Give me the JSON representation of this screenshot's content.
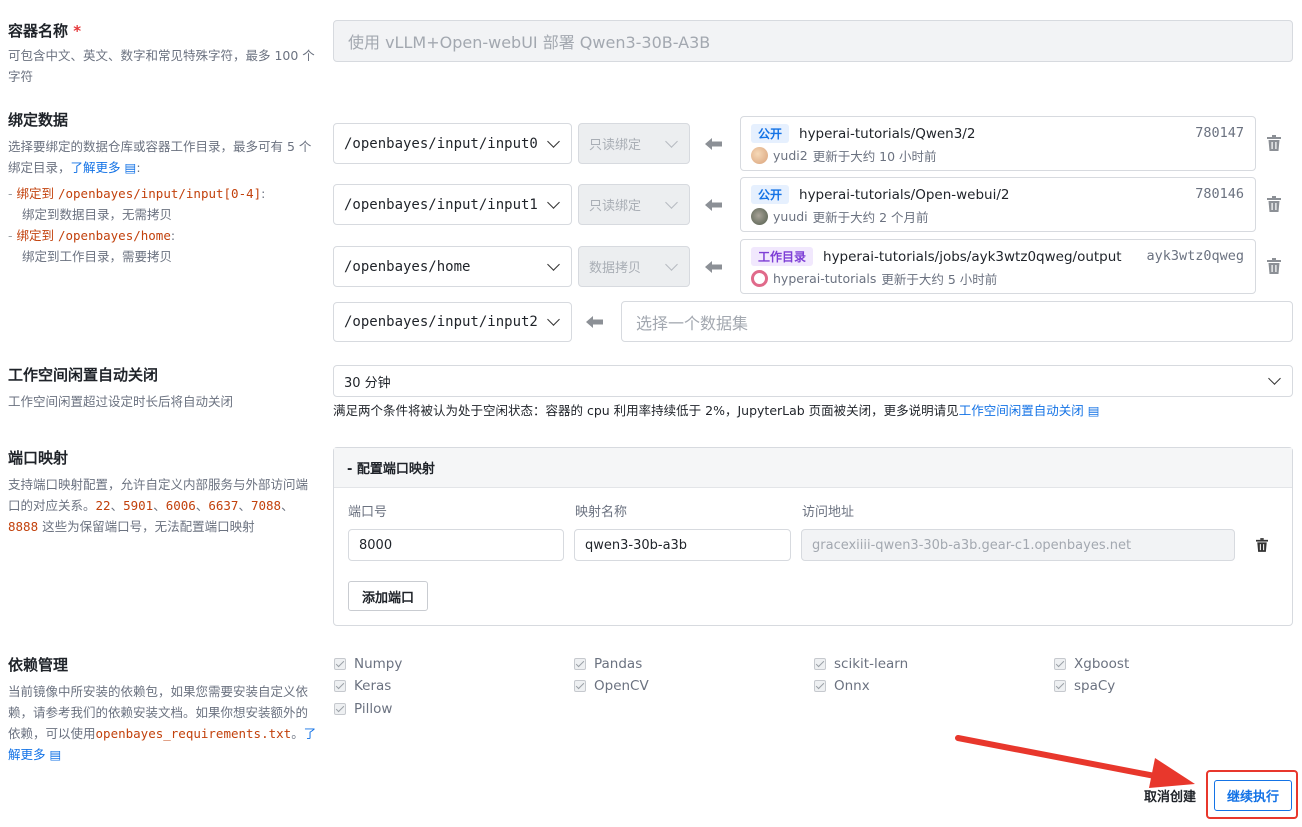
{
  "container_name": {
    "title": "容器名称",
    "required": "*",
    "desc": "可包含中文、英文、数字和常见特殊字符，最多 100 个字符",
    "placeholder": "使用 vLLM+Open-webUI 部署 Qwen3-30B-A3B"
  },
  "bind": {
    "title": "绑定数据",
    "desc": "选择要绑定的数据仓库或容器工作目录，最多可有 5 个绑定目录，",
    "learn_more": "了解更多",
    "note1_prefix": "绑定到 ",
    "note1_path": "/openbayes/input/input[0-4]",
    "note1_suffix": ":",
    "note1_desc": "绑定到数据目录，无需拷贝",
    "note2_prefix": "绑定到 ",
    "note2_path": "/openbayes/home",
    "note2_suffix": ":",
    "note2_desc": "绑定到工作目录，需要拷贝",
    "rows": [
      {
        "path": "/openbayes/input/input0",
        "mode": "只读绑定",
        "tag": "公开",
        "name": "hyperai-tutorials/Qwen3/2",
        "id": "780147",
        "user": "yudi2",
        "updated": "更新于大约 10 小时前"
      },
      {
        "path": "/openbayes/input/input1",
        "mode": "只读绑定",
        "tag": "公开",
        "name": "hyperai-tutorials/Open-webui/2",
        "id": "780146",
        "user": "yuudi",
        "updated": "更新于大约 2 个月前"
      },
      {
        "path": "/openbayes/home",
        "mode": "数据拷贝",
        "tag": "工作目录",
        "name": "hyperai-tutorials/jobs/ayk3wtz0qweg/output",
        "id": "ayk3wtz0qweg",
        "user": "hyperai-tutorials",
        "updated": "更新于大约 5 小时前"
      }
    ],
    "empty_path": "/openbayes/input/input2",
    "dataset_placeholder": "选择一个数据集"
  },
  "idle": {
    "title": "工作空间闲置自动关闭",
    "desc": "工作空间闲置超过设定时长后将自动关闭",
    "value": "30 分钟",
    "note": "满足两个条件将被认为处于空闲状态：容器的 cpu 利用率持续低于 2%，JupyterLab 页面被关闭，更多说明请见",
    "note_link": "工作空间闲置自动关闭"
  },
  "ports": {
    "title": "端口映射",
    "desc_a": "支持端口映射配置，允许自定义内部服务与外部访问端口的对应关系。",
    "reserved": [
      "22",
      "5901",
      "6006",
      "6637",
      "7088",
      "8888"
    ],
    "sep": "、",
    "desc_b": " 这些为保留端口号，无法配置端口映射",
    "panel_title": "- 配置端口映射",
    "col_port": "端口号",
    "col_name": "映射名称",
    "col_url": "访问地址",
    "port": "8000",
    "name": "qwen3-30b-a3b",
    "url": "gracexiiii-qwen3-30b-a3b.gear-c1.openbayes.net",
    "add_label": "添加端口"
  },
  "deps": {
    "title": "依赖管理",
    "desc": "当前镜像中所安装的依赖包，如果您需要安装自定义依赖，请参考我们的依赖安装文档。如果你想安装额外的依赖，可以使用",
    "file": "openbayes_requirements.txt",
    "tail": "。",
    "learn_more": "了解更多",
    "packages": [
      "Numpy",
      "Pandas",
      "scikit-learn",
      "Xgboost",
      "Keras",
      "OpenCV",
      "Onnx",
      "spaCy",
      "Pillow"
    ]
  },
  "footer": {
    "cancel": "取消创建",
    "continue": "继续执行"
  },
  "colors": {
    "accent": "#1473e6",
    "annotation": "#e8372c",
    "code": "#c2410c"
  }
}
